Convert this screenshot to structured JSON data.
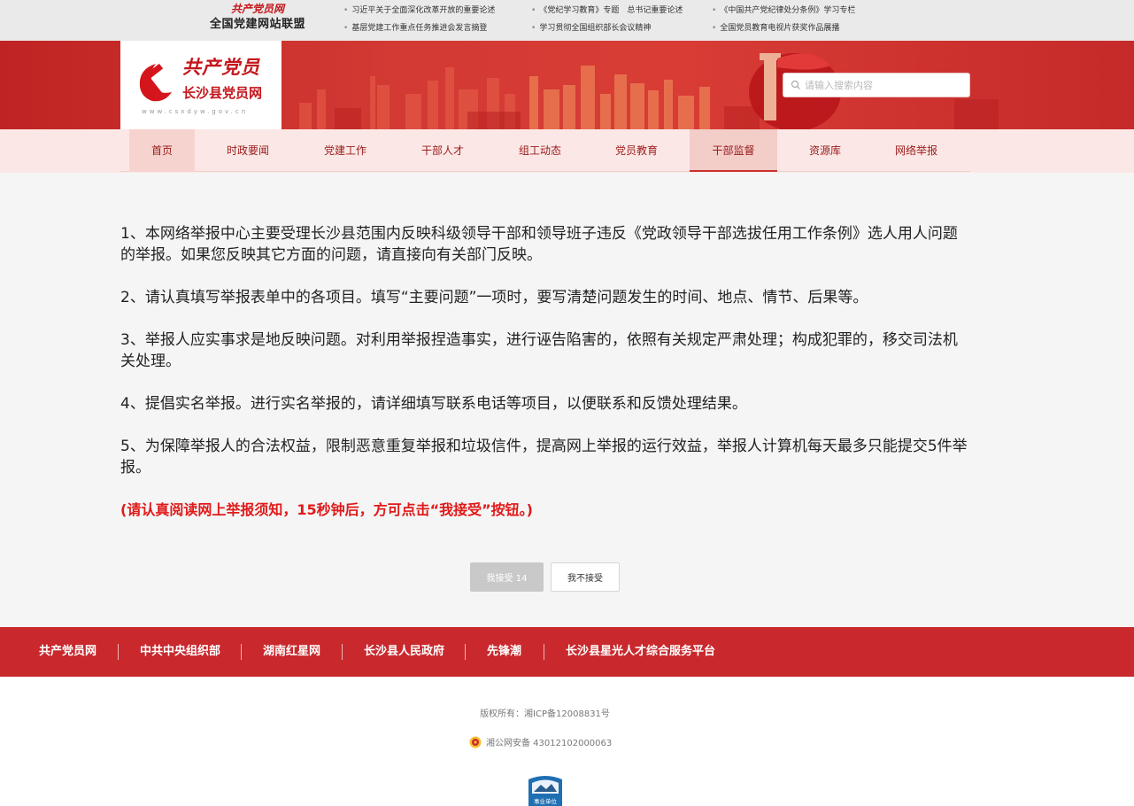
{
  "top_bar": {
    "alliance_brand": "共产党员网",
    "alliance_name": "全国党建网站联盟",
    "links": [
      "习近平关于全面深化改革开放的重要论述",
      "《党纪学习教育》专题　总书记重要论述",
      "《中国共产党纪律处分条例》学习专栏",
      "基层党建工作重点任务推进会发言摘登",
      "学习贯彻全国组织部长会议精神",
      "全国党员教育电视片获奖作品展播"
    ]
  },
  "header": {
    "logo_script": "共产党员",
    "logo_title": "长沙县党员网",
    "logo_url": "www.csxdyw.gov.cn",
    "search_placeholder": "请输入搜索内容"
  },
  "nav": {
    "items": [
      "首页",
      "时政要闻",
      "党建工作",
      "干部人才",
      "组工动态",
      "党员教育",
      "干部监督",
      "资源库",
      "网络举报"
    ],
    "active": "干部监督"
  },
  "notice": {
    "items": [
      "1、本网络举报中心主要受理长沙县范围内反映科级领导干部和领导班子违反《党政领导干部选拔任用工作条例》选人用人问题的举报。如果您反映其它方面的问题，请直接向有关部门反映。",
      "2、请认真填写举报表单中的各项目。填写“主要问题”一项时，要写清楚问题发生的时间、地点、情节、后果等。",
      "3、举报人应实事求是地反映问题。对利用举报捏造事实，进行诬告陷害的，依照有关规定严肃处理；构成犯罪的，移交司法机关处理。",
      "4、提倡实名举报。进行实名举报的，请详细填写联系电话等项目，以便联系和反馈处理结果。",
      "5、为保障举报人的合法权益，限制恶意重复举报和垃圾信件，提高网上举报的运行效益，举报人计算机每天最多只能提交5件举报。"
    ],
    "warning": "(请认真阅读网上举报须知，15秒钟后，方可点击“我接受”按钮。)"
  },
  "buttons": {
    "accept": "我接受 14",
    "reject": "我不接受"
  },
  "footer": {
    "links": [
      "共产党员网",
      "中共中央组织部",
      "湖南红星网",
      "长沙县人民政府",
      "先锋潮",
      "长沙县星光人才综合服务平台"
    ],
    "copyright": "版权所有：湘ICP备12008831号",
    "police_record": "湘公网安备 43012102000063",
    "badge_text": "事业单位"
  },
  "colors": {
    "brand_red": "#c4161c",
    "footer_red": "#c9282d",
    "warning_red": "#e01a1a",
    "nav_bg": "#fbe8e6"
  }
}
